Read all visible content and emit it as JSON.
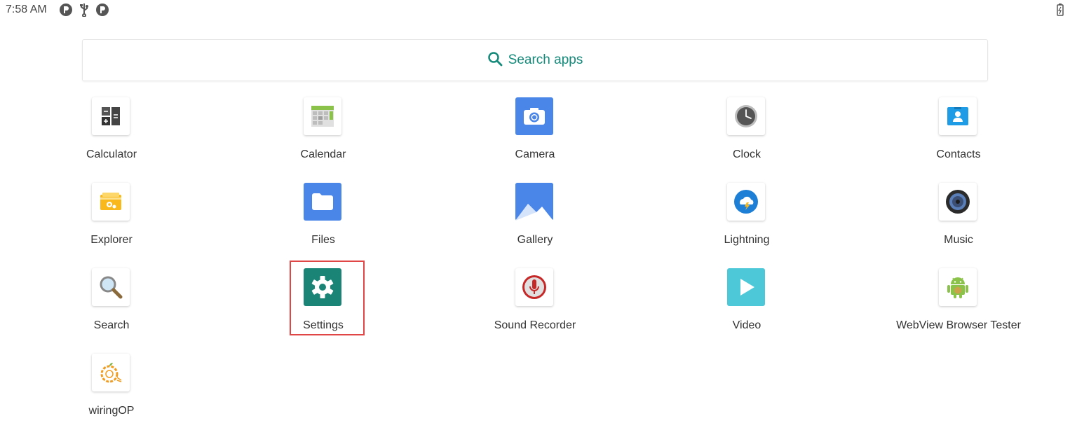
{
  "status_bar": {
    "time": "7:58 AM",
    "icons": [
      "p-badge-icon",
      "usb-icon",
      "p-badge-icon"
    ],
    "battery_icon": "battery-charging-icon"
  },
  "search": {
    "label": "Search apps",
    "icon": "search-icon",
    "accent_color": "#138a7a"
  },
  "apps": [
    {
      "label": "Calculator",
      "icon": "calculator-icon"
    },
    {
      "label": "Calendar",
      "icon": "calendar-icon"
    },
    {
      "label": "Camera",
      "icon": "camera-icon"
    },
    {
      "label": "Clock",
      "icon": "clock-icon"
    },
    {
      "label": "Contacts",
      "icon": "contacts-icon"
    },
    {
      "label": "Explorer",
      "icon": "explorer-icon"
    },
    {
      "label": "Files",
      "icon": "files-icon"
    },
    {
      "label": "Gallery",
      "icon": "gallery-icon"
    },
    {
      "label": "Lightning",
      "icon": "lightning-icon"
    },
    {
      "label": "Music",
      "icon": "music-icon"
    },
    {
      "label": "Search",
      "icon": "magnifier-icon"
    },
    {
      "label": "Settings",
      "icon": "gear-icon",
      "highlighted": true
    },
    {
      "label": "Sound Recorder",
      "icon": "microphone-icon"
    },
    {
      "label": "Video",
      "icon": "play-icon"
    },
    {
      "label": "WebView Browser Tester",
      "icon": "android-icon"
    },
    {
      "label": "wiringOP",
      "icon": "wiringop-icon"
    }
  ],
  "colors": {
    "highlight_border": "#e04646",
    "settings_bg": "#1a8577",
    "camera_bg": "#4a86e8",
    "files_bg": "#4a86e8",
    "video_bg": "#4dc8d8"
  }
}
